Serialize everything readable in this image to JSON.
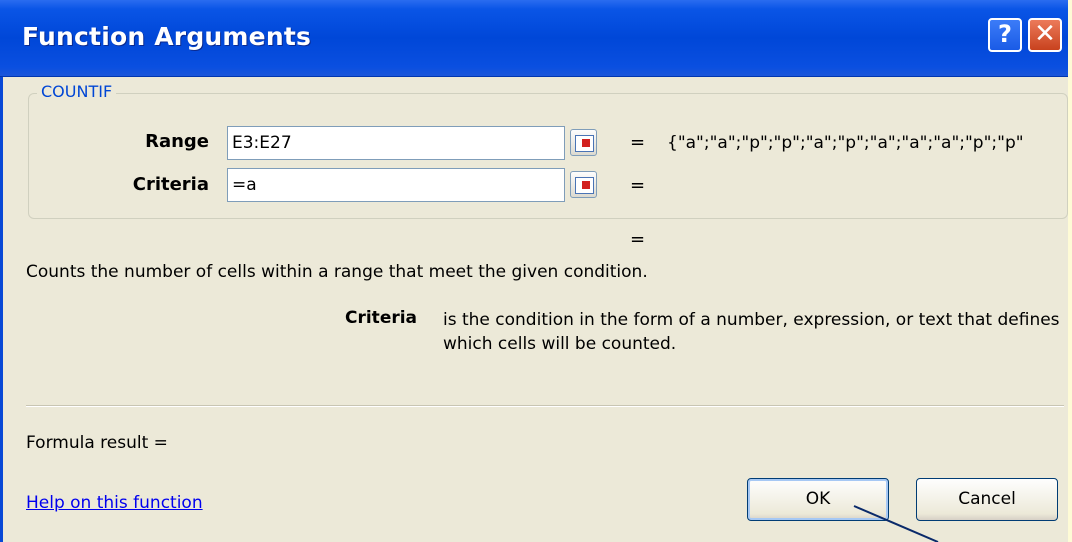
{
  "window": {
    "title": "Function Arguments",
    "help_glyph": "?",
    "close_glyph": "✕"
  },
  "function_group": {
    "name": "COUNTIF"
  },
  "arguments": [
    {
      "label": "Range",
      "value": "E3:E27",
      "result": "{\"a\";\"a\";\"p\";\"p\";\"a\";\"p\";\"a\";\"a\";\"a\";\"p\";\"p\""
    },
    {
      "label": "Criteria",
      "value": "=a",
      "result": ""
    }
  ],
  "equals": "=",
  "description": "Counts the number of cells within a range that meet the given condition.",
  "argument_help": {
    "name": "Criteria",
    "text": "is the condition in the form of a number, expression, or text that defines which cells will be counted."
  },
  "formula_result_label": "Formula result =",
  "help_link": "Help on this function",
  "buttons": {
    "ok": "OK",
    "cancel": "Cancel"
  },
  "colors": {
    "titlebar": "#0047d8",
    "dialog_bg": "#ece9d8",
    "group_label": "#0046d5",
    "link": "#0000ee",
    "page_bg": "#fefbd6"
  }
}
